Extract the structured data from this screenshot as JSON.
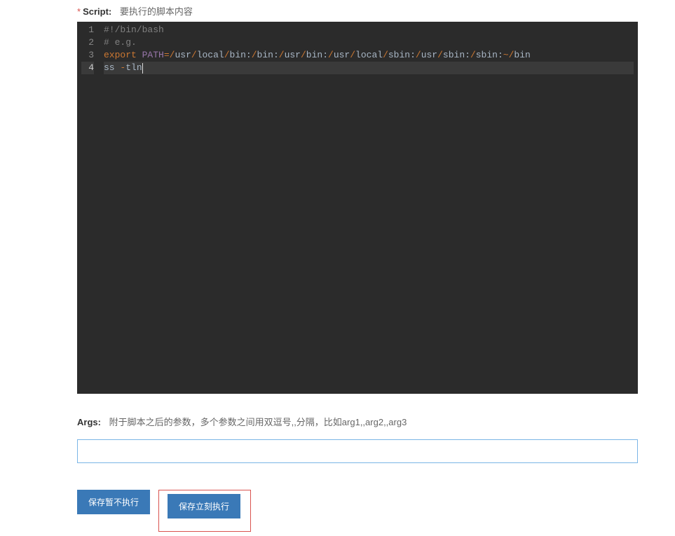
{
  "script_field": {
    "label": "Script:",
    "hint": "要执行的脚本内容",
    "required": true
  },
  "code": {
    "lines": [
      {
        "n": "1",
        "type": "comment",
        "raw": "#!/bin/bash"
      },
      {
        "n": "2",
        "type": "comment",
        "raw": "# e.g."
      },
      {
        "n": "3",
        "type": "export",
        "keyword": "export",
        "var": "PATH",
        "paths": [
          "usr",
          "local",
          "bin:",
          "bin:",
          "usr",
          "bin:",
          "usr",
          "local",
          "sbin:",
          "usr",
          "sbin:",
          "sbin:"
        ],
        "tail": "bin"
      },
      {
        "n": "4",
        "type": "cmd",
        "cmd": "ss ",
        "dash": "-",
        "flags": "tln",
        "active": true
      }
    ]
  },
  "args_field": {
    "label": "Args:",
    "hint": "附于脚本之后的参数，多个参数之间用双逗号,,分隔，比如arg1,,arg2,,arg3",
    "value": ""
  },
  "buttons": {
    "save_no_exec": "保存暂不执行",
    "save_exec": "保存立刻执行"
  }
}
